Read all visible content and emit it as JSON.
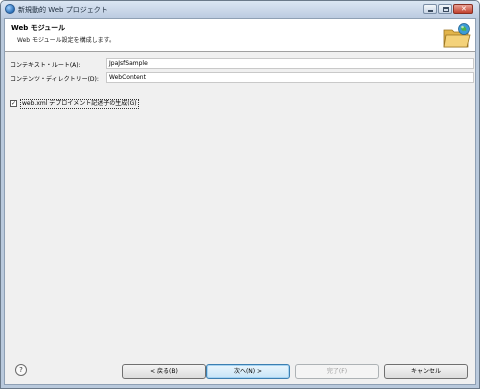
{
  "window": {
    "title": "新規動的 Web プロジェクト"
  },
  "banner": {
    "title": "Web モジュール",
    "description": "Web モジュール設定を構成します。"
  },
  "form": {
    "context_root": {
      "label": "コンテキスト・ルート(A):",
      "value": "JpaJsfSample"
    },
    "content_directory": {
      "label": "コンテンツ・ディレクトリー(D):",
      "value": "WebContent"
    },
    "generate_webxml": {
      "label": "web.xml デプロイメント記述子の生成(G)",
      "checked": true
    }
  },
  "buttons": {
    "help": "?",
    "back": "< 戻る(B)",
    "next": "次へ(N) >",
    "finish": "完了(F)",
    "cancel": "キャンセル"
  },
  "colors": {
    "title_bar": "#bccbe0",
    "close_button": "#c2412e",
    "default_button": "#c7e4f7"
  }
}
